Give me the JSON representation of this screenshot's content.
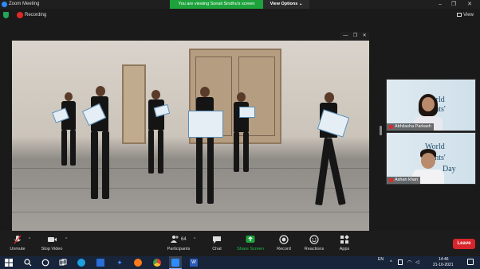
{
  "window": {
    "title": "Zoom Meeting",
    "controls": [
      "–",
      "❐",
      "✕"
    ]
  },
  "share_banner": {
    "viewing_text": "You are viewing Sonali Sindhu's screen",
    "view_options_label": "View Options ⌄"
  },
  "status": {
    "recording_label": "Recording",
    "view_label": "View"
  },
  "shared_window_controls": [
    "—",
    "❐",
    "✕"
  ],
  "participants": [
    {
      "name": "Abhilasha Parkash",
      "background_words": [
        "World",
        "idents'"
      ]
    },
    {
      "name": "Ashan khan",
      "background_words": [
        "World",
        "idents'",
        "Day"
      ]
    }
  ],
  "toolbar": {
    "unmute": "Unmute",
    "stop_video": "Stop Video",
    "participants_label": "Participants",
    "participants_count": "64",
    "chat": "Chat",
    "share_screen": "Share Screen",
    "record": "Record",
    "reactions": "Reactions",
    "apps": "Apps",
    "leave": "Leave"
  },
  "taskbar": {
    "language": "EN",
    "time": "14:46",
    "date": "21-10-2021"
  },
  "colors": {
    "share_green": "#1ea33c",
    "leave_red": "#d7262b",
    "taskbar_bg": "#17243a"
  }
}
